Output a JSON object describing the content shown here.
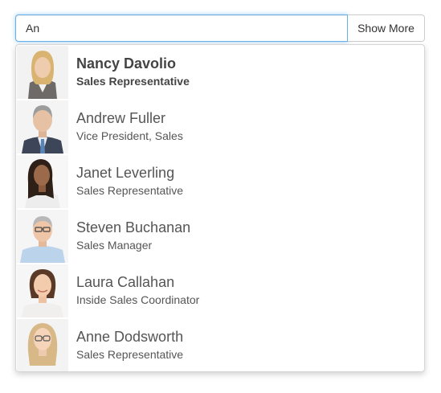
{
  "search": {
    "value": "An",
    "button_label": "Show More"
  },
  "results": [
    {
      "name": "Nancy Davolio",
      "title": "Sales Representative",
      "photo_icon": "woman-blonde-suit-photo",
      "active": true
    },
    {
      "name": "Andrew Fuller",
      "title": "Vice President, Sales",
      "photo_icon": "man-gray-suit-photo",
      "active": false
    },
    {
      "name": "Janet Leverling",
      "title": "Sales Representative",
      "photo_icon": "woman-dark-hair-photo",
      "active": false
    },
    {
      "name": "Steven Buchanan",
      "title": "Sales Manager",
      "photo_icon": "man-glasses-photo",
      "active": false
    },
    {
      "name": "Laura Callahan",
      "title": "Inside Sales Coordinator",
      "photo_icon": "woman-brown-hair-photo",
      "active": false
    },
    {
      "name": "Anne Dodsworth",
      "title": "Sales Representative",
      "photo_icon": "woman-glasses-photo",
      "active": false
    }
  ],
  "colors": {
    "focus_border": "#66afe9",
    "text": "#555555"
  }
}
